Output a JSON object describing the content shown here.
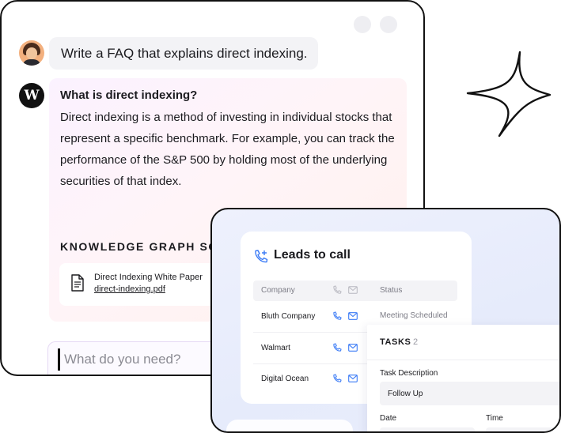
{
  "chat": {
    "user_message": "Write a FAQ that explains direct indexing.",
    "answer": {
      "title": "What is direct indexing?",
      "body": "Direct indexing is a method of investing in individual stocks that represent a specific benchmark. For example, you can track the performance of the S&P 500 by holding most of the underlying securities of that index."
    },
    "knowledge_heading": "KNOWLEDGE GRAPH SOU",
    "source": {
      "title": "Direct Indexing White Paper",
      "file": "direct-indexing.pdf"
    },
    "input_placeholder": "What do you need?",
    "bot_logo_letter": "W"
  },
  "leads": {
    "title": "Leads to call",
    "columns": {
      "company": "Company",
      "status": "Status"
    },
    "rows": [
      {
        "company": "Bluth Company",
        "status": "Meeting Scheduled"
      },
      {
        "company": "Walmart"
      },
      {
        "company": "Digital Ocean"
      }
    ]
  },
  "tasks": {
    "heading": "TASKS",
    "count": "2",
    "description_label": "Task Description",
    "description_value": "Follow Up",
    "date_label": "Date",
    "time_label": "Time"
  },
  "colors": {
    "accent_blue": "#3b7bf6",
    "icon_gray": "#b8b8c0",
    "outline": "#111111"
  },
  "icons": [
    "document-icon",
    "phone-plus-icon",
    "phone-icon",
    "mail-icon",
    "sparkle-icon"
  ]
}
